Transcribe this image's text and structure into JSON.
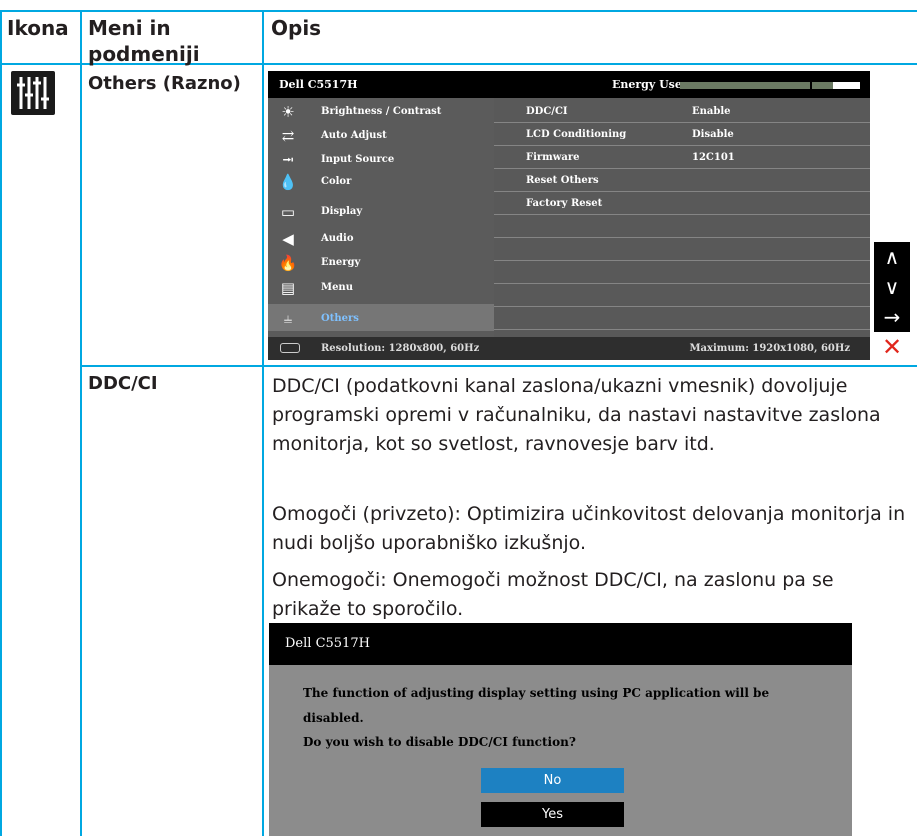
{
  "table": {
    "headers": [
      "Ikona",
      "Meni in podmeniji",
      "Opis"
    ],
    "rows": [
      {
        "icon": "others-icon",
        "menu": "Others (Razno)"
      },
      {
        "menu": "DDC/CI"
      }
    ]
  },
  "osd": {
    "brand": "Dell C5517H",
    "energy_label": "Energy Use",
    "energy_level": 0.85,
    "menu_items": [
      {
        "icon": "brightness-icon",
        "label": "Brightness / Contrast"
      },
      {
        "icon": "auto-adjust-icon",
        "label": "Auto Adjust"
      },
      {
        "icon": "input-source-icon",
        "label": "Input Source"
      },
      {
        "icon": "color-icon",
        "label": "Color"
      },
      {
        "icon": "display-icon",
        "label": "Display"
      },
      {
        "icon": "audio-icon",
        "label": "Audio"
      },
      {
        "icon": "energy-icon",
        "label": "Energy"
      },
      {
        "icon": "menu-icon",
        "label": "Menu"
      },
      {
        "icon": "others-icon",
        "label": "Others",
        "selected": true
      }
    ],
    "submenu": [
      {
        "key": "DDC/CI",
        "value": "Enable"
      },
      {
        "key": "LCD Conditioning",
        "value": "Disable"
      },
      {
        "key": "Firmware",
        "value": "12C101"
      },
      {
        "key": "Reset Others",
        "value": ""
      },
      {
        "key": "Factory Reset",
        "value": ""
      }
    ],
    "resolution": "Resolution: 1280x800, 60Hz",
    "maximum": "Maximum: 1920x1080, 60Hz"
  },
  "nav_buttons": [
    "up-arrow-icon",
    "down-arrow-icon",
    "right-arrow-icon",
    "close-icon"
  ],
  "description": {
    "p1": "DDC/CI (podatkovni kanal zaslona/ukazni vmesnik) dovoljuje programski opremi v računalniku, da nastavi nastavitve zaslona monitorja, kot so svetlost, ravnovesje barv itd.",
    "p2": "Omogoči (privzeto): Optimizira učinkovitost delovanja monitorja in nudi boljšo uporabniško izkušnjo.",
    "p3": "Onemogoči: Onemogoči možnost DDC/CI, na zaslonu pa se prikaže to sporočilo."
  },
  "dialog": {
    "title": "Dell C5517H",
    "line1": "The function of adjusting display setting using PC application will be",
    "line2": "disabled.",
    "line3": "Do you wish to disable DDC/CI function?",
    "no_label": "No",
    "yes_label": "Yes"
  },
  "colors": {
    "rule": "#00a8e1",
    "selected_text": "#7fc1ff",
    "no_button": "#1d81c2",
    "close": "#e1261c"
  }
}
